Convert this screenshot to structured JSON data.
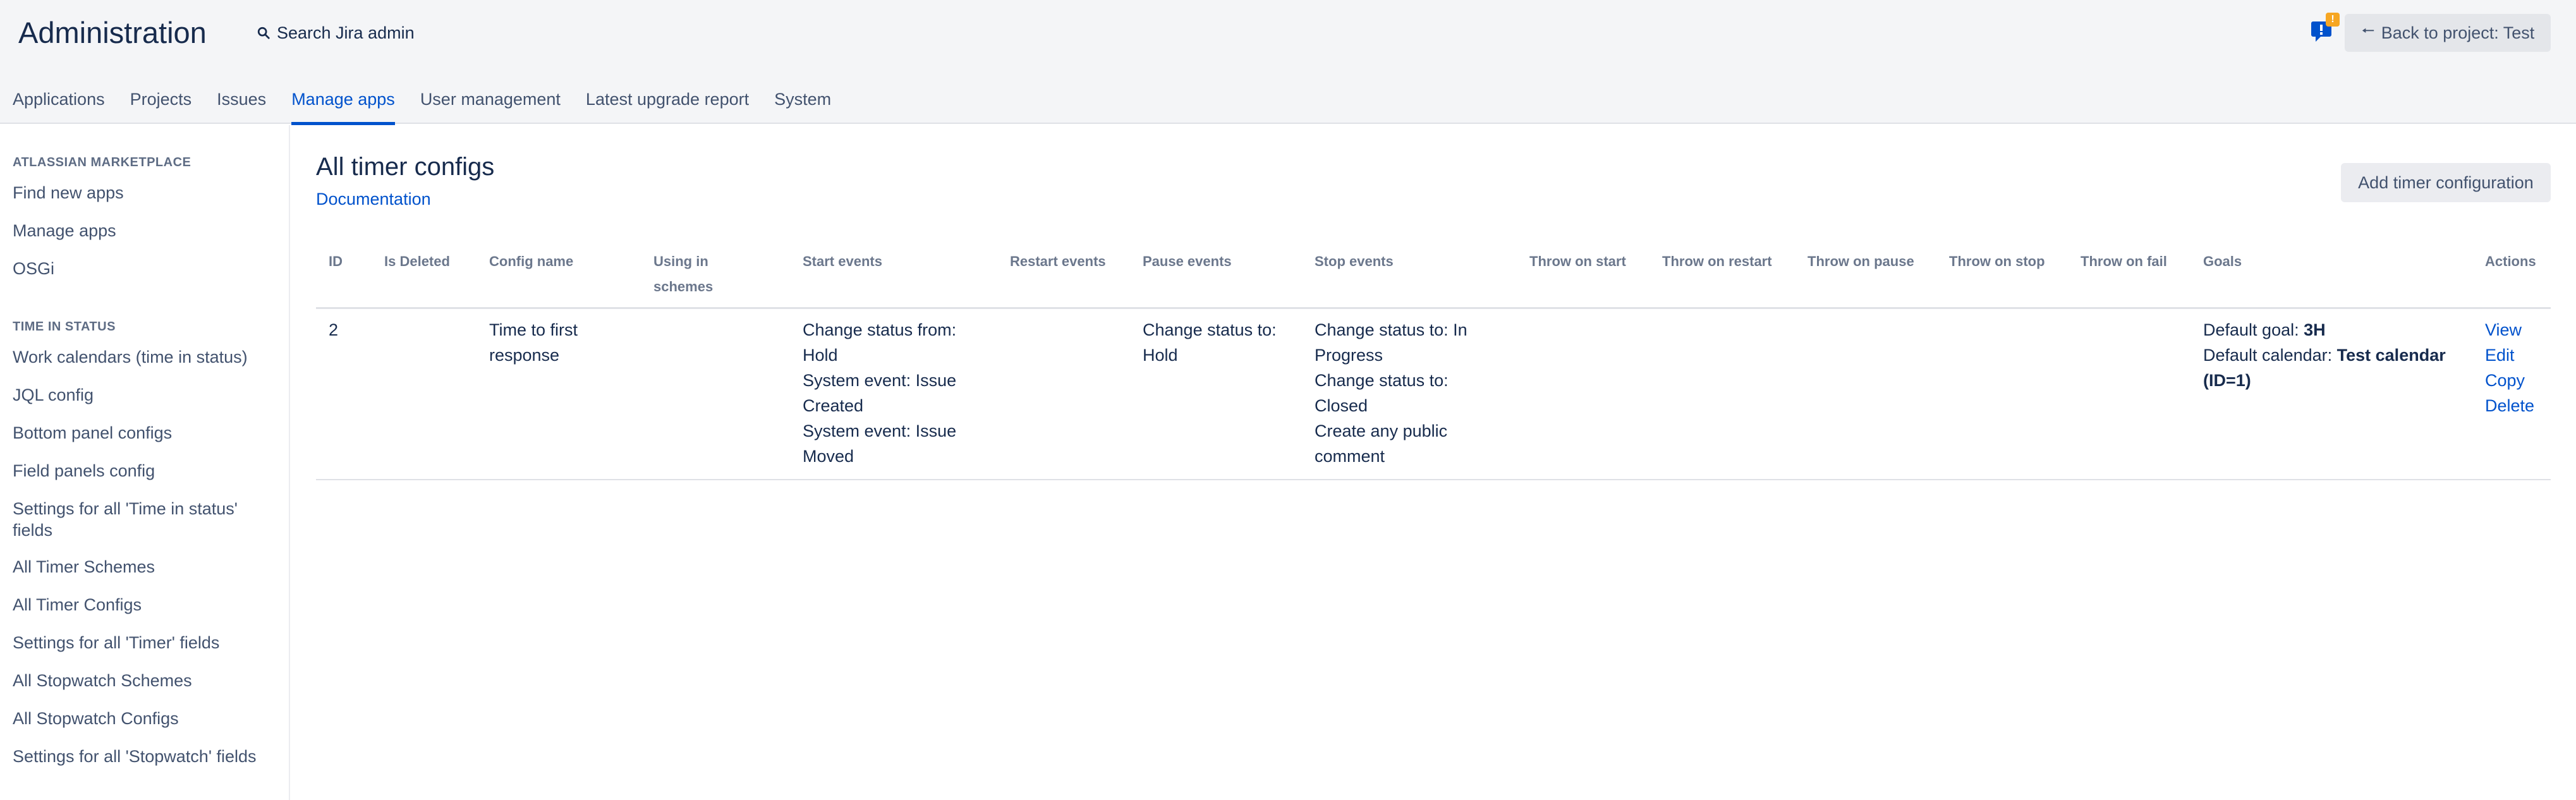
{
  "header": {
    "title": "Administration",
    "search_label": "Search Jira admin",
    "feedback_badge": "!",
    "back_button": "Back to project: Test"
  },
  "tabs": [
    {
      "label": "Applications"
    },
    {
      "label": "Projects"
    },
    {
      "label": "Issues"
    },
    {
      "label": "Manage apps",
      "active": true
    },
    {
      "label": "User management"
    },
    {
      "label": "Latest upgrade report"
    },
    {
      "label": "System"
    }
  ],
  "sidebar": {
    "section1": {
      "heading": "ATLASSIAN MARKETPLACE",
      "items": [
        "Find new apps",
        "Manage apps",
        "OSGi"
      ]
    },
    "section2": {
      "heading": "TIME IN STATUS",
      "items": [
        "Work calendars (time in status)",
        "JQL config",
        "Bottom panel configs",
        "Field panels config",
        "Settings for all 'Time in status' fields",
        "All Timer Schemes",
        "All Timer Configs",
        "Settings for all 'Timer' fields",
        "All Stopwatch Schemes",
        "All Stopwatch Configs",
        "Settings for all 'Stopwatch' fields"
      ]
    }
  },
  "main": {
    "title": "All timer configs",
    "doc_link": "Documentation",
    "add_button": "Add timer configuration"
  },
  "table": {
    "columns": [
      "ID",
      "Is Deleted",
      "Config name",
      "Using in schemes",
      "Start events",
      "Restart events",
      "Pause events",
      "Stop events",
      "Throw on start",
      "Throw on restart",
      "Throw on pause",
      "Throw on stop",
      "Throw on fail",
      "Goals",
      "Actions"
    ],
    "rows": [
      {
        "id": "2",
        "is_deleted": "",
        "config_name": "Time to first response",
        "using_in_schemes": "",
        "start_events": [
          "Change status from: Hold",
          "System event: Issue Created",
          "System event: Issue Moved"
        ],
        "restart_events": "",
        "pause_events": [
          "Change status to: Hold"
        ],
        "stop_events": [
          "Change status to: In Progress",
          "Change status to: Closed",
          "Create any public comment"
        ],
        "goal_label": "Default goal:",
        "goal_value": "3H",
        "calendar_label": "Default calendar:",
        "calendar_value": "Test calendar (ID=1)",
        "actions": [
          "View",
          "Edit",
          "Copy",
          "Delete"
        ]
      }
    ]
  },
  "colors": {
    "link": "#0052cc",
    "header_bg": "#f4f5f7",
    "text": "#172b4d",
    "badge": "#f6a623"
  }
}
